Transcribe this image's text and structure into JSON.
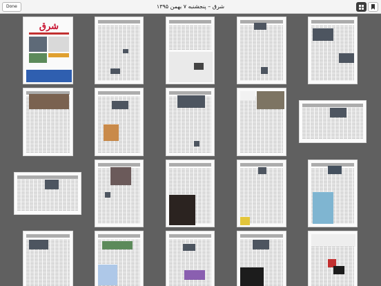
{
  "toolbar": {
    "done_label": "Done",
    "title": "شرق – پنجشنبه ۷ بهمن ۱۳۹۵",
    "grid_icon": "grid-icon",
    "bookmark_icon": "bookmark-icon"
  },
  "front_page": {
    "masthead": "شرق"
  },
  "colors": {
    "background": "#606060",
    "toolbar": "#f4f4f4",
    "accent_red": "#c8102e"
  }
}
